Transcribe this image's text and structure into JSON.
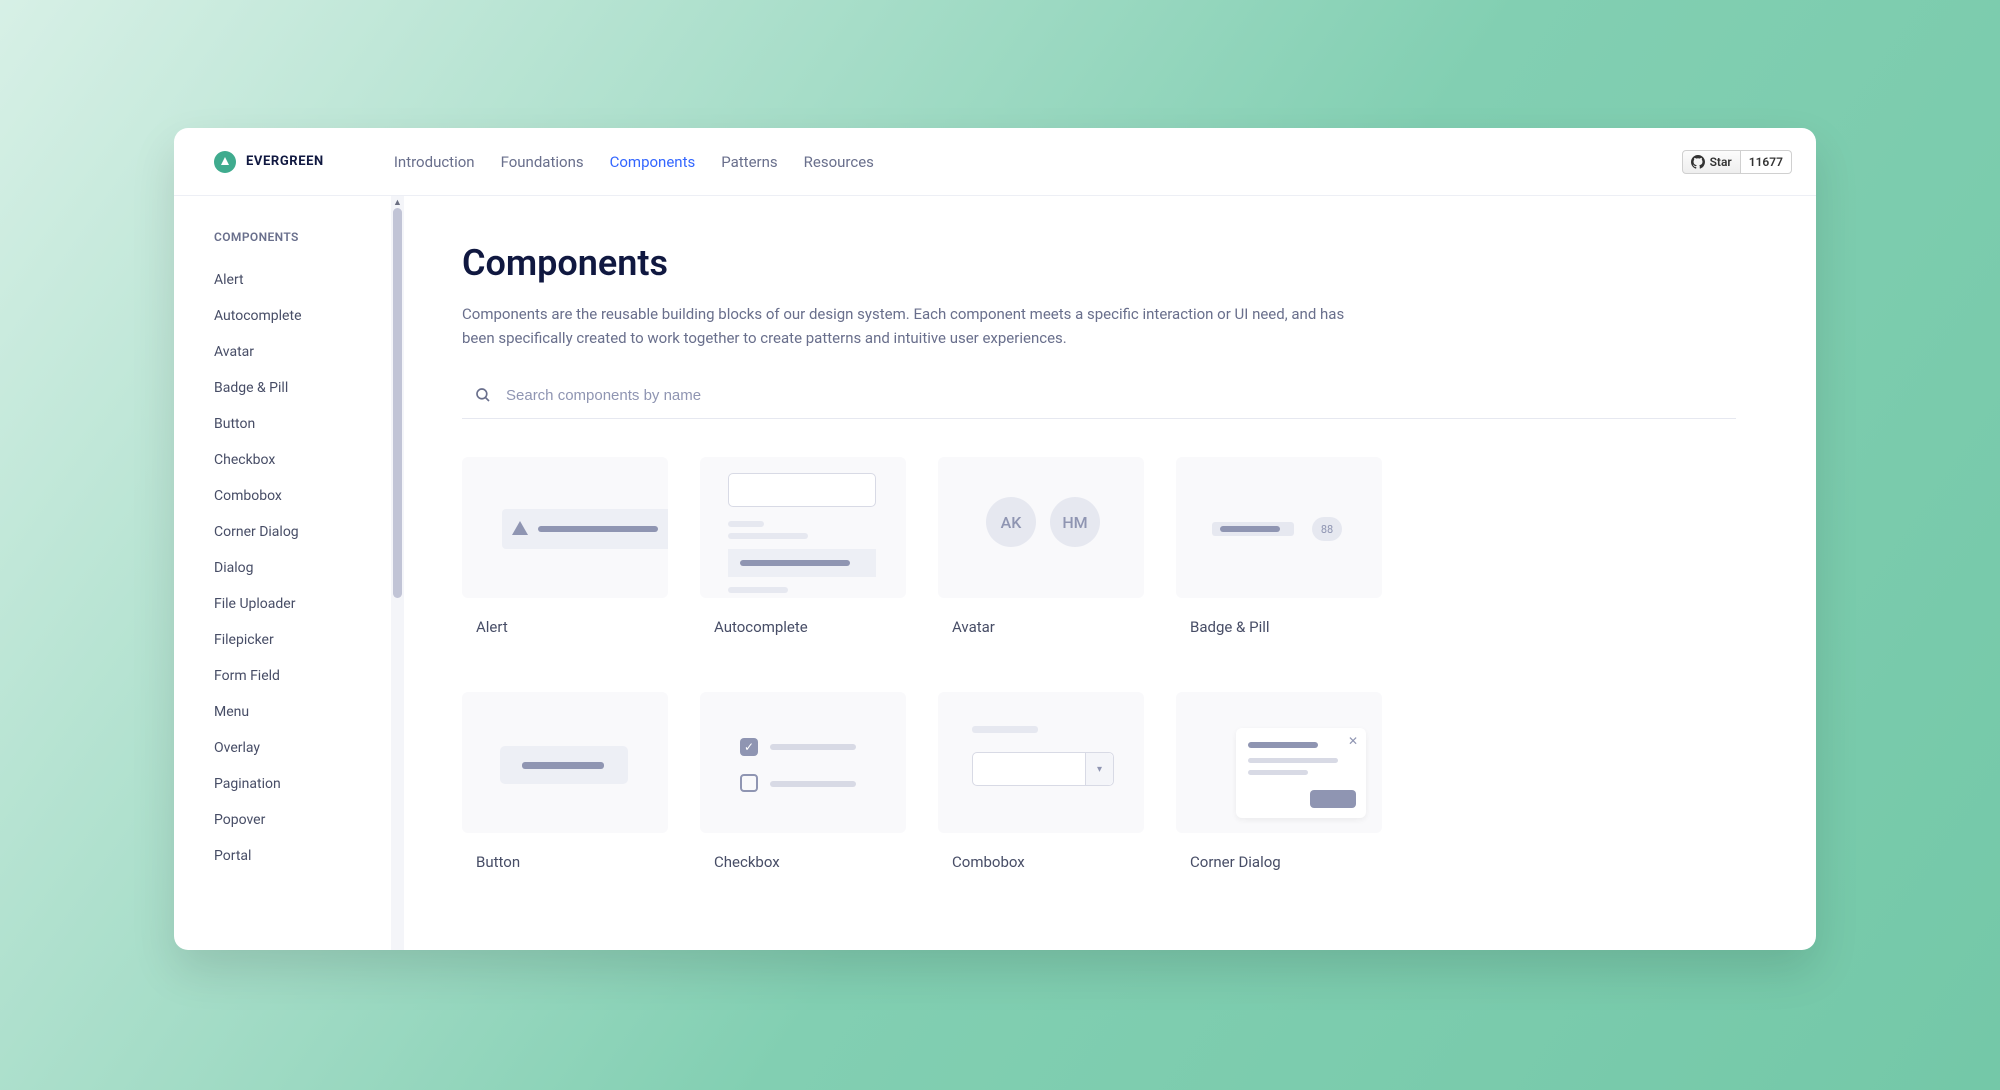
{
  "brand": {
    "name": "EVERGREEN"
  },
  "nav": {
    "items": [
      "Introduction",
      "Foundations",
      "Components",
      "Patterns",
      "Resources"
    ],
    "active_index": 2
  },
  "github": {
    "label": "Star",
    "count": "11677"
  },
  "sidebar": {
    "heading": "COMPONENTS",
    "items": [
      "Alert",
      "Autocomplete",
      "Avatar",
      "Badge & Pill",
      "Button",
      "Checkbox",
      "Combobox",
      "Corner Dialog",
      "Dialog",
      "File Uploader",
      "Filepicker",
      "Form Field",
      "Menu",
      "Overlay",
      "Pagination",
      "Popover",
      "Portal"
    ]
  },
  "page": {
    "title": "Components",
    "description": "Components are the reusable building blocks of our design system. Each component meets a specific interaction or UI need, and has been specifically created to work together to create patterns and intuitive user experiences."
  },
  "search": {
    "placeholder": "Search components by name"
  },
  "cards": [
    {
      "label": "Alert"
    },
    {
      "label": "Autocomplete"
    },
    {
      "label": "Avatar",
      "initials": [
        "AK",
        "HM"
      ]
    },
    {
      "label": "Badge & Pill",
      "pill": "88"
    },
    {
      "label": "Button"
    },
    {
      "label": "Checkbox"
    },
    {
      "label": "Combobox"
    },
    {
      "label": "Corner Dialog"
    }
  ]
}
